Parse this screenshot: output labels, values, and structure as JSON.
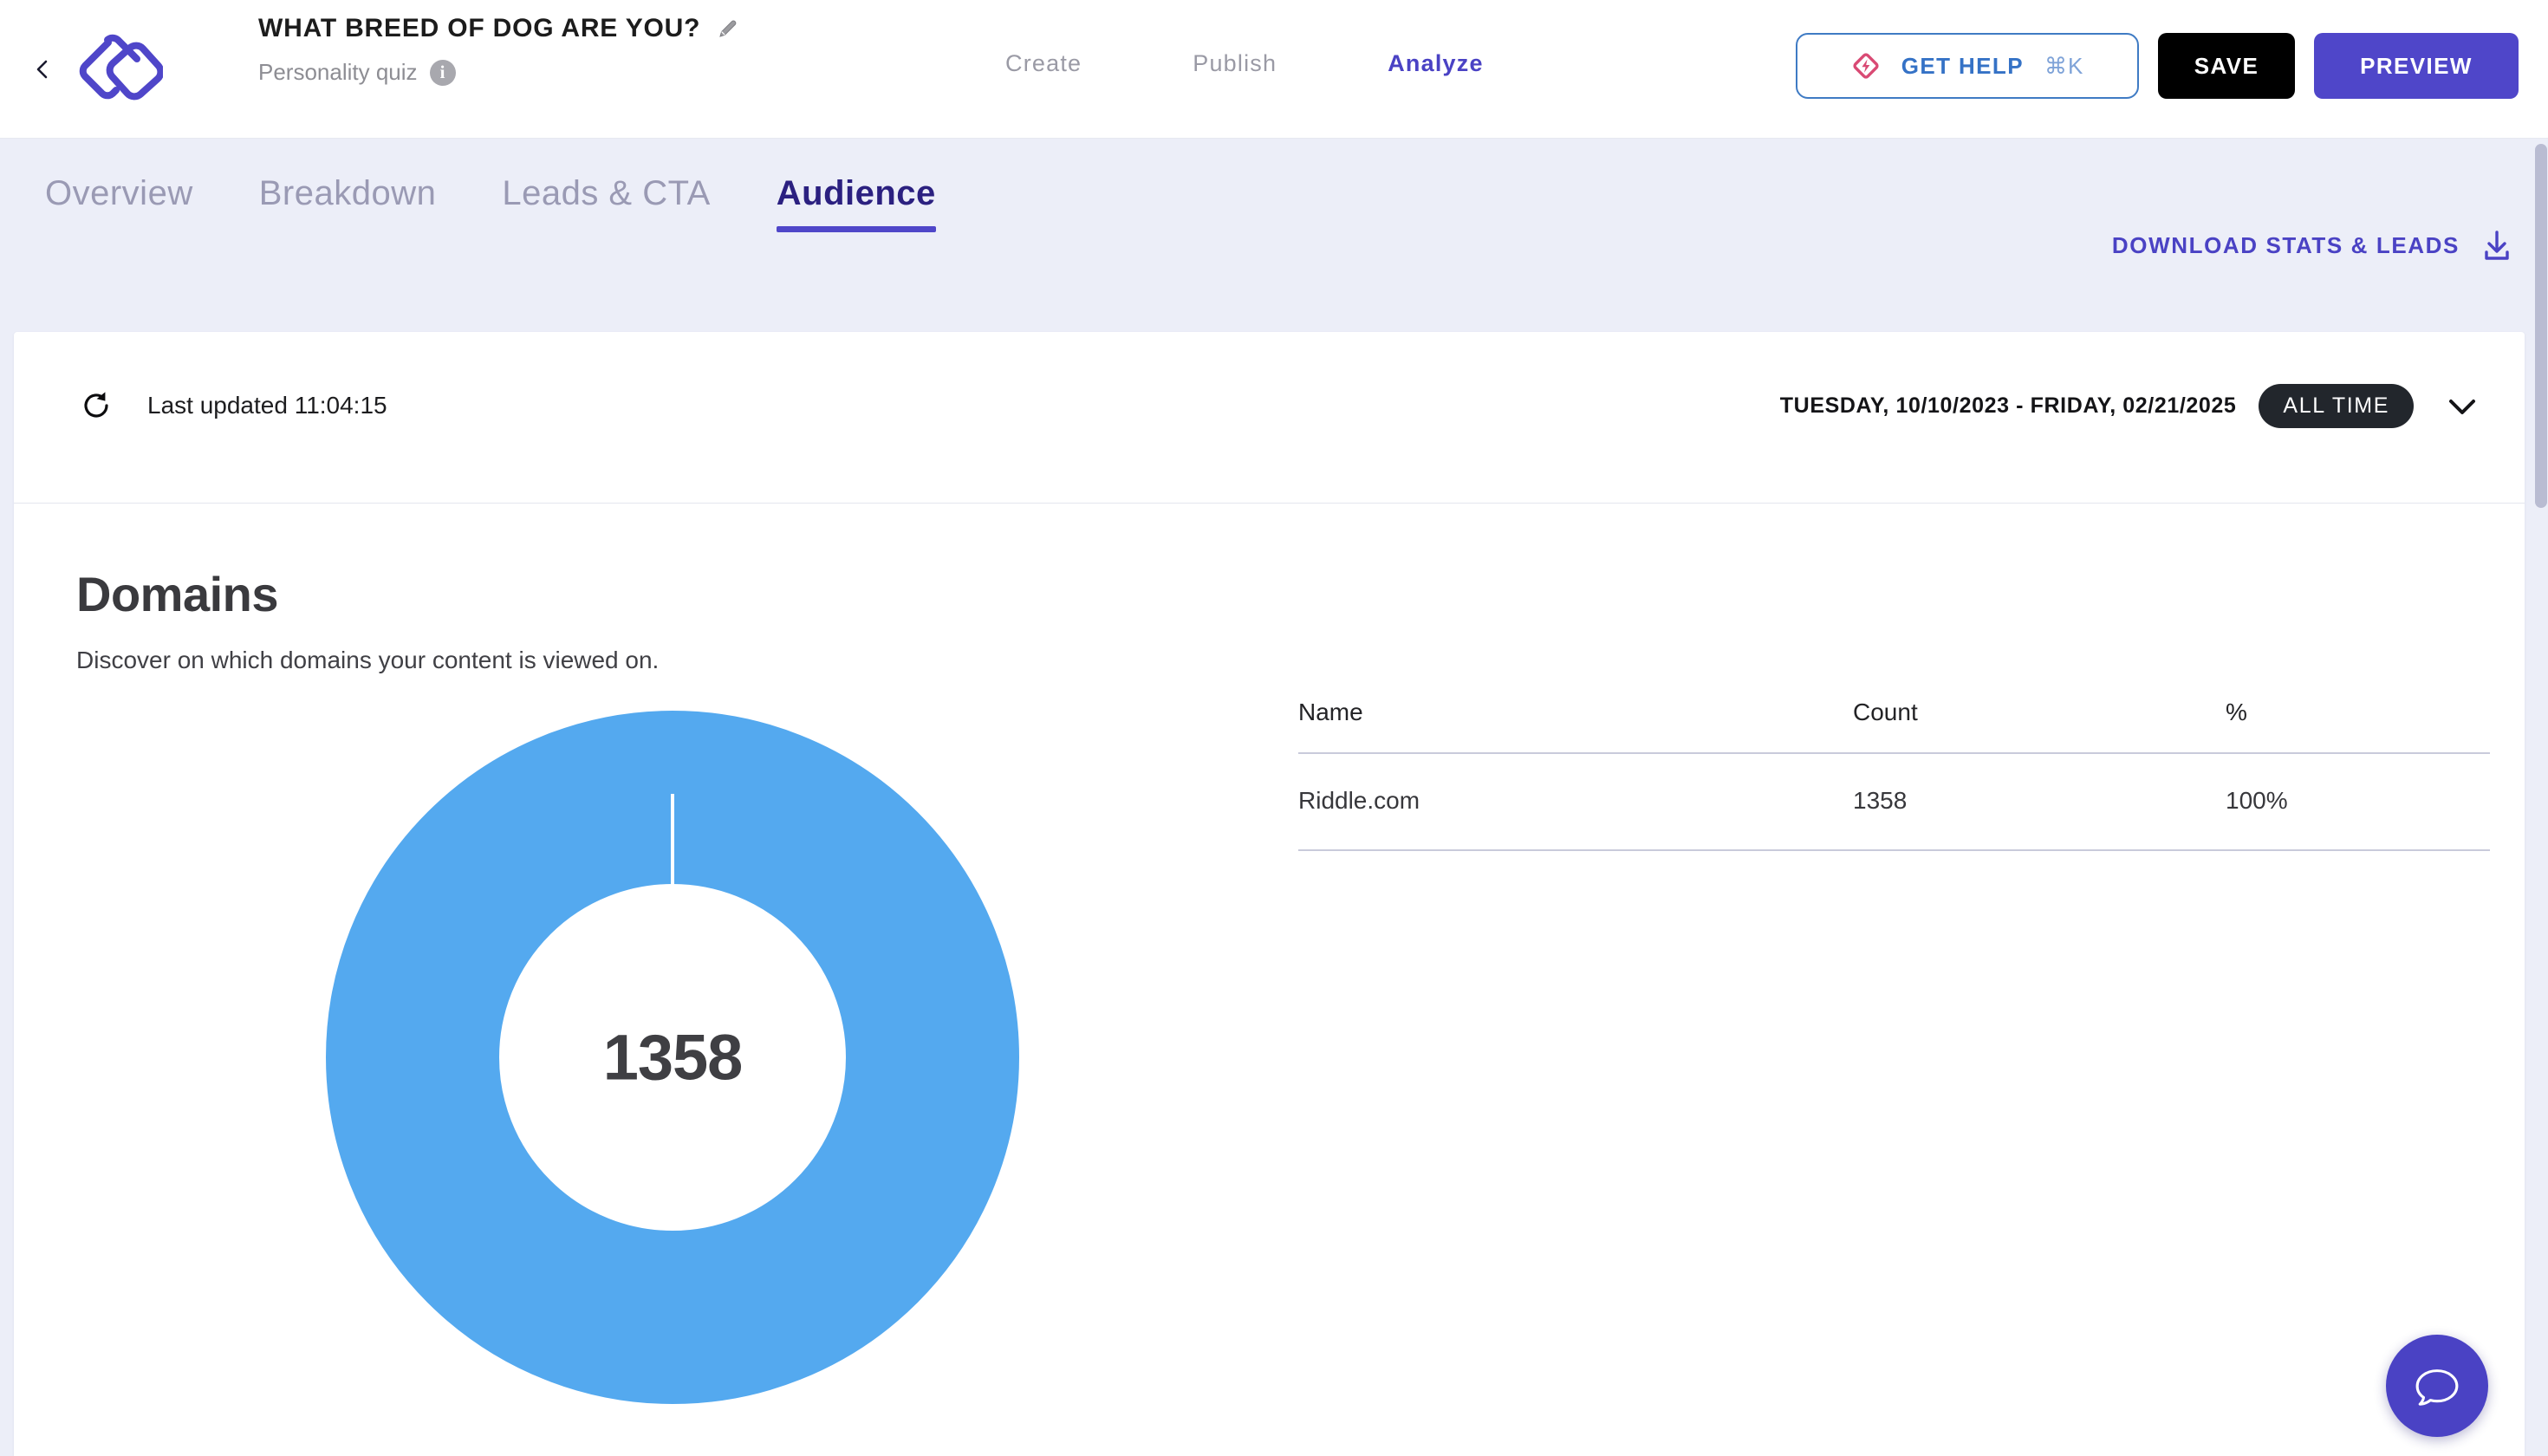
{
  "header": {
    "back_icon": "chevron-left-icon",
    "logo_icon": "riddle-logo",
    "quiz_title": "WHAT BREED OF DOG ARE YOU?",
    "edit_icon": "pencil-icon",
    "quiz_type": "Personality quiz",
    "info_icon": "i",
    "nav": [
      {
        "label": "Create",
        "active": false
      },
      {
        "label": "Publish",
        "active": false
      },
      {
        "label": "Analyze",
        "active": true
      }
    ],
    "get_help": {
      "label": "GET HELP",
      "shortcut": "⌘K",
      "icon": "lightning-diamond-icon",
      "border_color": "#3f7bc4",
      "text_color": "#3572c6"
    },
    "save_label": "SAVE",
    "preview_label": "PREVIEW"
  },
  "tabs": [
    {
      "label": "Overview",
      "active": false
    },
    {
      "label": "Breakdown",
      "active": false
    },
    {
      "label": "Leads & CTA",
      "active": false
    },
    {
      "label": "Audience",
      "active": true
    }
  ],
  "download": {
    "label": "DOWNLOAD STATS & LEADS",
    "icon": "download-icon"
  },
  "refresh_bar": {
    "refresh_icon": "refresh-icon",
    "last_updated": "Last updated 11:04:15",
    "date_range": "TUESDAY, 10/10/2023 - FRIDAY, 02/21/2025",
    "range_badge": "ALL TIME",
    "chevron_icon": "chevron-down-icon"
  },
  "domains": {
    "title": "Domains",
    "description": "Discover on which domains your content is viewed on.",
    "center_total": "1358",
    "table": {
      "columns": [
        "Name",
        "Count",
        "%"
      ],
      "rows": [
        {
          "name": "Riddle.com",
          "count": "1358",
          "pct": "100%"
        }
      ]
    }
  },
  "chart_data": {
    "type": "pie",
    "title": "Domains",
    "subtitle": "Discover on which domains your content is viewed on.",
    "donut": true,
    "inner_radius_ratio": 0.5,
    "center_label": "1358",
    "total": 1358,
    "labels": [
      "Riddle.com"
    ],
    "values": [
      1358
    ],
    "percentages": [
      100
    ],
    "colors": [
      "#54a9ef"
    ],
    "legend": "table-right",
    "grid": false
  },
  "chat_widget": {
    "icon": "chat-bubble-icon",
    "color": "#4a42c4"
  },
  "theme": {
    "page_bg": "#eceef8",
    "card_bg": "#ffffff",
    "accent_purple": "#4f46c9",
    "donut_blue": "#54a9ef",
    "badge_black": "#22262c"
  }
}
